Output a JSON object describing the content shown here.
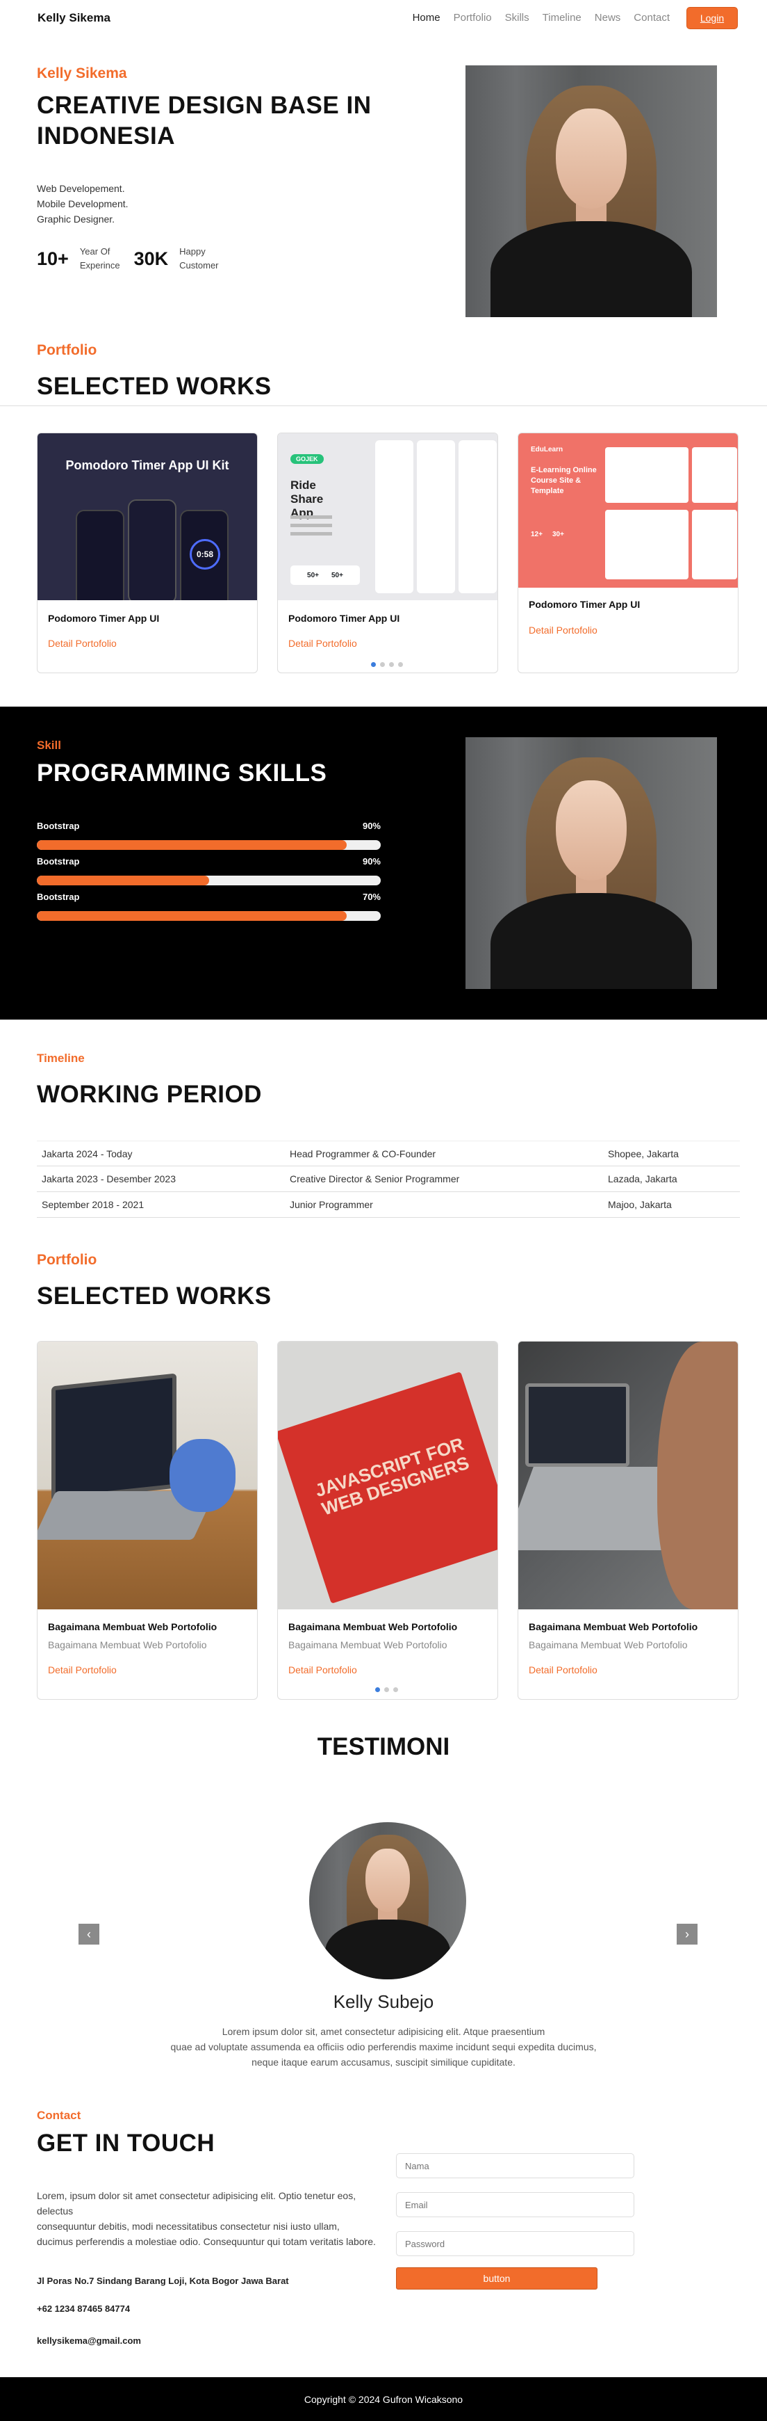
{
  "nav": {
    "brand": "Kelly Sikema",
    "links": [
      "Home",
      "Portfolio",
      "Skills",
      "Timeline",
      "News",
      "Contact"
    ],
    "login": "Login"
  },
  "hero": {
    "name": "Kelly Sikema",
    "title_line1": "CREATIVE DESIGN BASE IN",
    "title_line2": "INDONESIA",
    "roles": [
      "Web Developement.",
      "Mobile Development.",
      "Graphic Designer."
    ],
    "stats": [
      {
        "num": "10+",
        "label1": "Year Of",
        "label2": "Experince"
      },
      {
        "num": "30K",
        "label1": "Happy",
        "label2": "Customer"
      }
    ]
  },
  "portfolio1": {
    "sub": "Portfolio",
    "title": "SELECTED WORKS",
    "cards": [
      {
        "title": "Podomoro Timer App UI",
        "link": "Detail Portofolio",
        "thumb_title": "Pomodoro Timer App UI  Kit",
        "thumb_time": "0:58"
      },
      {
        "title": "Podomoro Timer App UI",
        "link": "Detail Portofolio",
        "thumb_title": "Ride Share App",
        "thumb_badge": "GOJEK",
        "thumb_stat1": "50+",
        "thumb_stat2": "50+"
      },
      {
        "title": "Podomoro Timer App UI",
        "link": "Detail Portofolio",
        "thumb_title": "E-Learning Online Course Site & Template",
        "thumb_logo": "EduLearn",
        "thumb_stat1": "12+",
        "thumb_stat2": "30+"
      }
    ]
  },
  "skills": {
    "sub": "Skill",
    "title": "PROGRAMMING SKILLS",
    "items": [
      {
        "name": "Bootstrap",
        "percent_label": "90%",
        "level": 0.9
      },
      {
        "name": "Bootstrap",
        "percent_label": "90%",
        "level": 0.5
      },
      {
        "name": "Bootstrap",
        "percent_label": "70%",
        "level": 0.9
      }
    ]
  },
  "timeline": {
    "sub": "Timeline",
    "title": "WORKING PERIOD",
    "rows": [
      {
        "period": "Jakarta 2024 - Today",
        "role": "Head Programmer & CO-Founder",
        "company": "Shopee, Jakarta"
      },
      {
        "period": "Jakarta 2023 - Desember 2023",
        "role": "Creative Director & Senior Programmer",
        "company": "Lazada, Jakarta"
      },
      {
        "period": "September 2018 - 2021",
        "role": "Junior Programmer",
        "company": "Majoo, Jakarta"
      }
    ]
  },
  "portfolio2": {
    "sub": "Portfolio",
    "title": "SELECTED WORKS",
    "cards": [
      {
        "title": "Bagaimana Membuat Web Portofolio",
        "subtitle": "Bagaimana Membuat Web Portofolio",
        "link": "Detail Portofolio"
      },
      {
        "title": "Bagaimana Membuat Web Portofolio",
        "subtitle": "Bagaimana Membuat Web Portofolio",
        "link": "Detail Portofolio",
        "book_text": "JAVASCRIPT FOR WEB DESIGNERS"
      },
      {
        "title": "Bagaimana Membuat Web Portofolio",
        "subtitle": "Bagaimana Membuat Web Portofolio",
        "link": "Detail Portofolio"
      }
    ]
  },
  "testimoni": {
    "title": "TESTIMONI",
    "name": "Kelly Subejo",
    "text_line1": "Lorem ipsum dolor sit, amet consectetur adipisicing elit. Atque praesentium",
    "text_line2": "quae ad voluptate assumenda ea officiis odio perferendis maxime incidunt sequi expedita ducimus,",
    "text_line3": "neque itaque earum accusamus, suscipit similique cupiditate."
  },
  "contact": {
    "sub": "Contact",
    "title": "GET IN TOUCH",
    "text_line1": "Lorem, ipsum dolor sit amet consectetur adipisicing elit. Optio tenetur eos, delectus",
    "text_line2": "consequuntur debitis, modi necessitatibus consectetur nisi iusto ullam,",
    "text_line3": "ducimus perferendis a molestiae odio. Consequuntur qui totam veritatis labore.",
    "address": "Jl Poras No.7 Sindang Barang Loji, Kota Bogor Jawa Barat",
    "phone": "+62 1234 87465 84774",
    "email": "kellysikema@gmail.com",
    "form": {
      "name_placeholder": "Nama",
      "email_placeholder": "Email",
      "password_placeholder": "Password",
      "button": "button"
    }
  },
  "footer": {
    "text": "Copyright © 2024 Gufron Wicaksono"
  }
}
